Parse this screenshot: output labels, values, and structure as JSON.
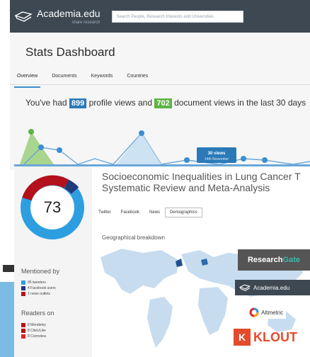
{
  "academia": {
    "brand": "Academia.edu",
    "tagline": "share research",
    "search_placeholder": "Search People, Research Interests and Universities",
    "dashboard_title": "Stats Dashboard",
    "tabs": [
      "Overview",
      "Documents",
      "Keywords",
      "Countries"
    ],
    "stats": {
      "prefix": "You've had",
      "profile_views": "899",
      "middle": "profile views and",
      "document_views": "702",
      "suffix": "document views in the last 30 days"
    },
    "tooltip": {
      "views": "30 views",
      "date": "14th November"
    }
  },
  "altmetric": {
    "score": "73",
    "paper_title_line1": "Socioeconomic Inequalities in Lung Cancer T",
    "paper_title_line2": "Systematic Review and Meta-Analysis",
    "tabs": [
      "Twitter",
      "Facebook",
      "News",
      "Demographics"
    ],
    "active_tab": "Demographics",
    "geo_heading": "Geographical breakdown",
    "mentioned_heading": "Mentioned by",
    "mentioned": [
      {
        "label": "95 tweeters",
        "color": "#2d9fe0"
      },
      {
        "label": "4 Facebook users",
        "color": "#1f3b7a"
      },
      {
        "label": "1 news outlets",
        "color": "#b3111b"
      }
    ],
    "readers_heading": "Readers on",
    "readers": [
      {
        "label": "8 Mendeley",
        "color": "#b3111b"
      },
      {
        "label": "8 CiteULike",
        "color": "#b3111b"
      },
      {
        "label": "8 Connotea",
        "color": "#e0242b"
      }
    ]
  },
  "badges": {
    "researchgate_a": "Research",
    "researchgate_b": "Gate",
    "academia": "Academia.edu",
    "altmetric": "Altmetric",
    "klout": "KLOUT"
  },
  "colors": {
    "academia_bar": "#3d4852",
    "profile_views_badge": "#2a7ab8",
    "document_views_badge": "#5cb444",
    "klout": "#e44b2b"
  }
}
